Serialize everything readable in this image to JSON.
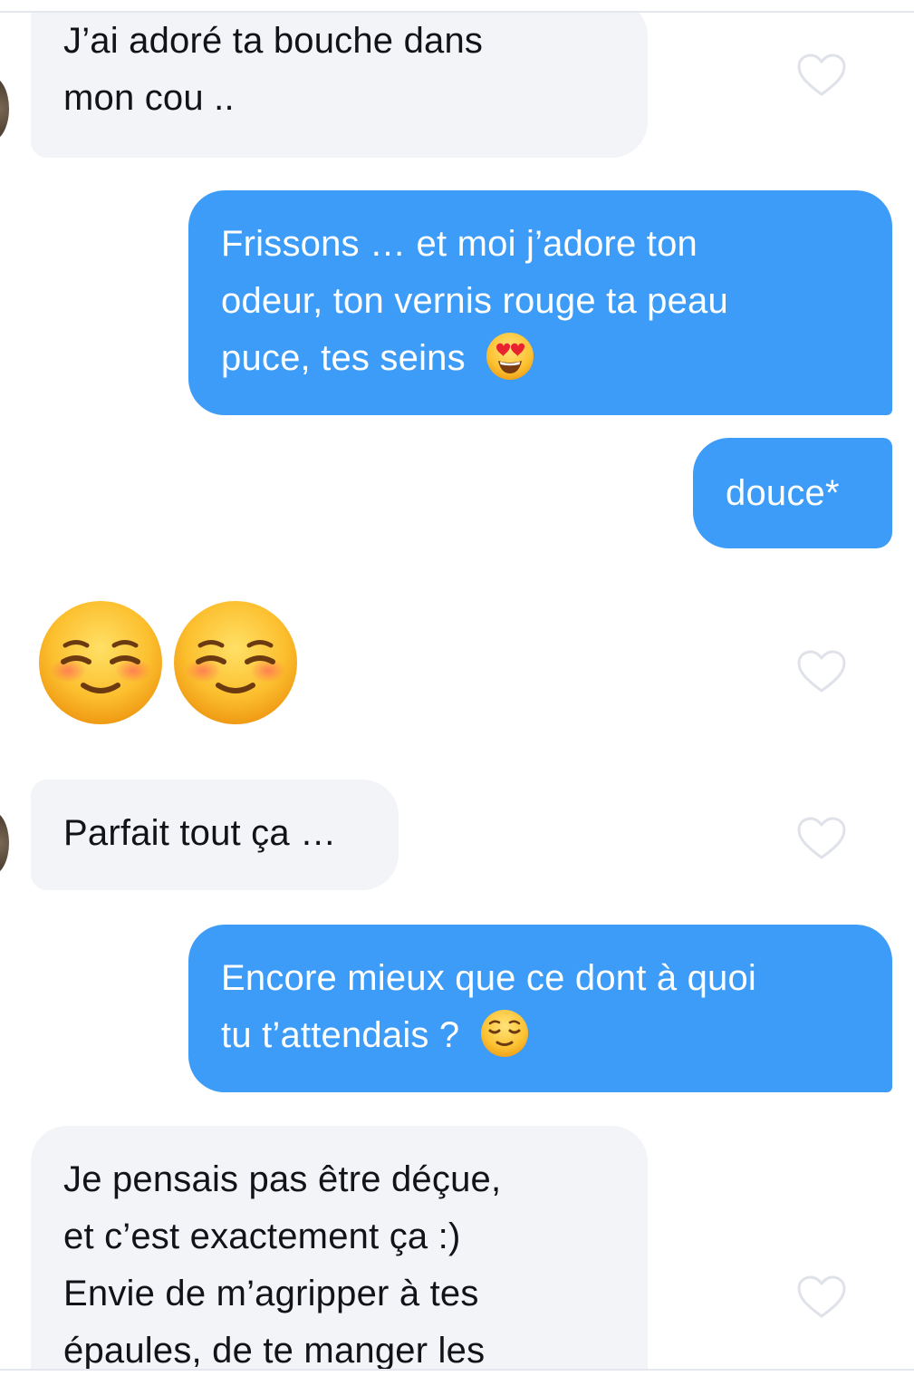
{
  "messages": [
    {
      "id": "m1",
      "sender": "match",
      "lines": [
        "J’ai adoré ta bouche dans",
        "mon cou .."
      ]
    },
    {
      "id": "m2",
      "sender": "me",
      "lines": [
        "Frissons … et moi j’adore ton",
        "odeur, ton vernis rouge ta peau",
        "puce, tes seins"
      ],
      "trailing_emoji": "smiling-face-with-heart-eyes"
    },
    {
      "id": "m3",
      "sender": "me",
      "lines": [
        "douce*"
      ]
    },
    {
      "id": "m4",
      "sender": "match",
      "emoji_only": [
        "smiling-face",
        "smiling-face"
      ]
    },
    {
      "id": "m5",
      "sender": "match",
      "lines": [
        "Parfait tout ça …"
      ]
    },
    {
      "id": "m6",
      "sender": "me",
      "lines": [
        "Encore mieux que ce dont à quoi",
        "tu t’attendais ?"
      ],
      "trailing_emoji": "relieved-face"
    },
    {
      "id": "m7",
      "sender": "match",
      "lines": [
        "Je pensais pas être déçue,",
        "et c’est exactement ça :)",
        "Envie de m’agripper à tes",
        "épaules, de te manger les"
      ]
    }
  ],
  "colors": {
    "incoming_bubble": "#f3f4f8",
    "outgoing_bubble": "#3d9cf7",
    "incoming_text": "#111318",
    "outgoing_text": "#ffffff",
    "like_icon": "#dfe2e8"
  },
  "icons": {
    "like": "heart-outline-icon"
  }
}
